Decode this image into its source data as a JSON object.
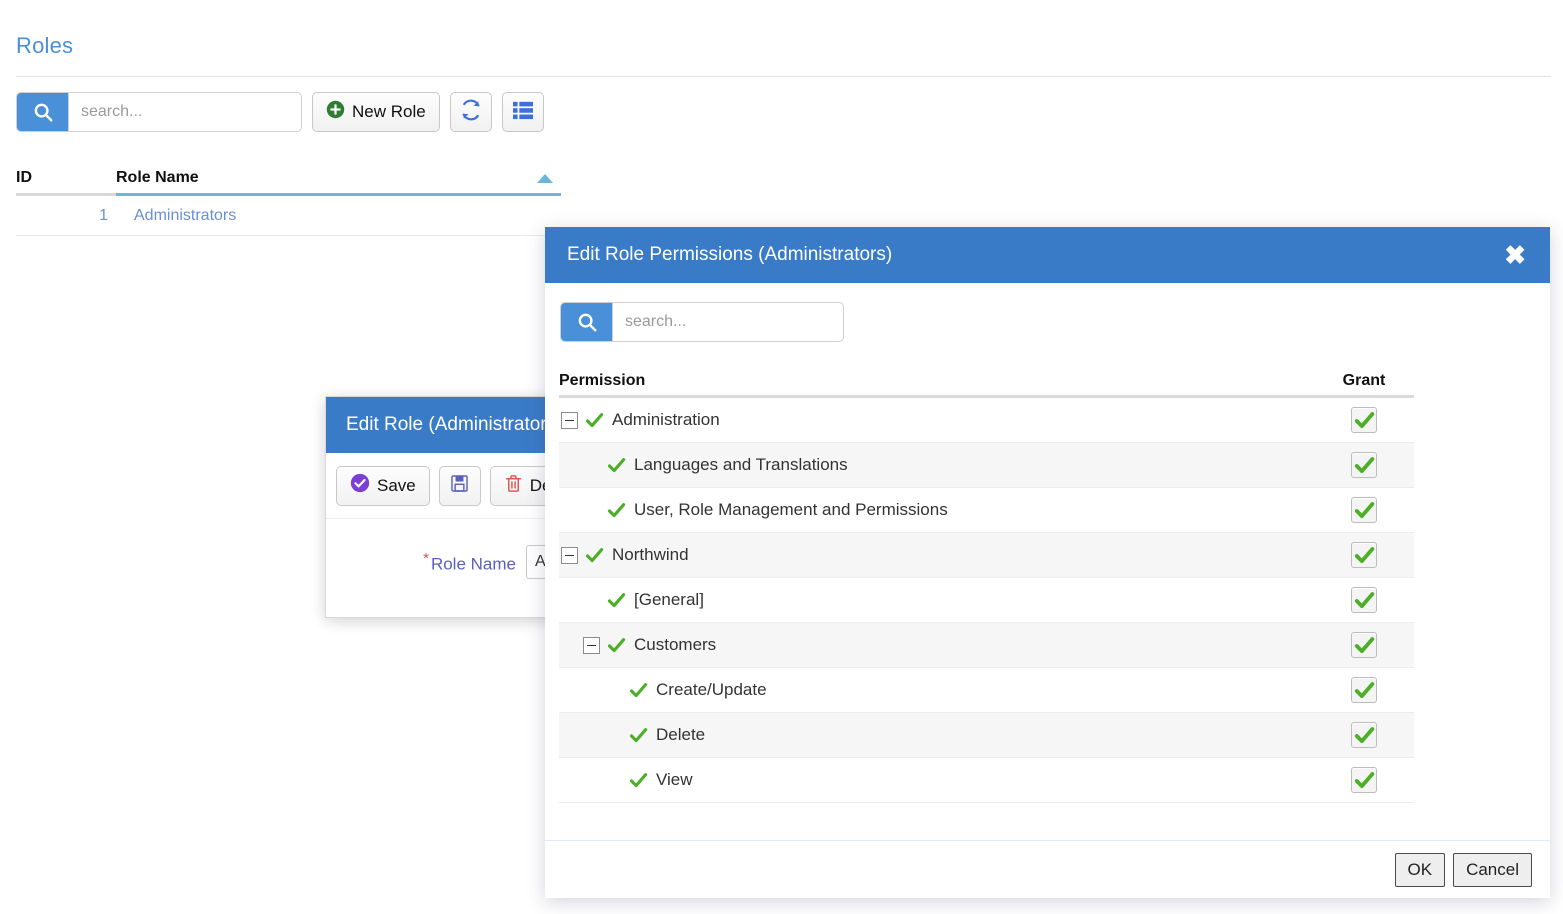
{
  "page": {
    "title": "Roles",
    "search": {
      "placeholder": "search...",
      "value": "",
      "icon": "search-icon"
    },
    "toolbar": {
      "new_role_label": "New Role",
      "new_role_icon": "plus-circle-icon",
      "refresh_icon": "refresh-icon",
      "columns_icon": "list-view-icon"
    },
    "grid": {
      "columns": [
        "ID",
        "Role Name"
      ],
      "sort_column": "Role Name",
      "sort_direction": "ascending",
      "rows": [
        {
          "id": "1",
          "name": "Administrators"
        }
      ]
    }
  },
  "edit_role_dialog": {
    "title": "Edit Role (Administrators)",
    "buttons": {
      "save_label": "Save",
      "save_icon": "check-circle-icon",
      "save_as_icon": "floppy-disk-icon",
      "delete_label": "Delete",
      "delete_icon": "trash-icon"
    },
    "fields": {
      "role_name_label": "Role Name",
      "role_name_required_marker": "*",
      "role_name_value": "Administrators"
    }
  },
  "permissions_modal": {
    "title": "Edit Role Permissions (Administrators)",
    "close_icon": "close-icon",
    "search": {
      "placeholder": "search...",
      "value": "",
      "icon": "search-icon"
    },
    "table": {
      "columns": [
        "Permission",
        "Grant"
      ],
      "rows": [
        {
          "label": "Administration",
          "level": 0,
          "expandable": true,
          "expanded": true,
          "checked": true,
          "granted": true
        },
        {
          "label": "Languages and Translations",
          "level": 1,
          "expandable": false,
          "expanded": false,
          "checked": true,
          "granted": true
        },
        {
          "label": "User, Role Management and Permissions",
          "level": 1,
          "expandable": false,
          "expanded": false,
          "checked": true,
          "granted": true
        },
        {
          "label": "Northwind",
          "level": 0,
          "expandable": true,
          "expanded": true,
          "checked": true,
          "granted": true
        },
        {
          "label": "[General]",
          "level": 1,
          "expandable": false,
          "expanded": false,
          "checked": true,
          "granted": true
        },
        {
          "label": "Customers",
          "level": 1,
          "expandable": true,
          "expanded": true,
          "checked": true,
          "granted": true
        },
        {
          "label": "Create/Update",
          "level": 2,
          "expandable": false,
          "expanded": false,
          "checked": true,
          "granted": true
        },
        {
          "label": "Delete",
          "level": 2,
          "expandable": false,
          "expanded": false,
          "checked": true,
          "granted": true
        },
        {
          "label": "View",
          "level": 2,
          "expandable": false,
          "expanded": false,
          "checked": true,
          "granted": true
        }
      ]
    },
    "footer": {
      "ok_label": "OK",
      "cancel_label": "Cancel"
    }
  },
  "colors": {
    "accent_blue": "#4a90d9",
    "header_blue": "#3a7bc8",
    "title_blue": "#4a90d9",
    "link_blue": "#6a8fd4",
    "check_green": "#4caf27",
    "sort_underline": "#6cb6d9",
    "required_red": "#d9534f",
    "label_purple": "#5a5fbf",
    "delete_red": "#e05a52",
    "save_purple": "#7b3fd4"
  }
}
